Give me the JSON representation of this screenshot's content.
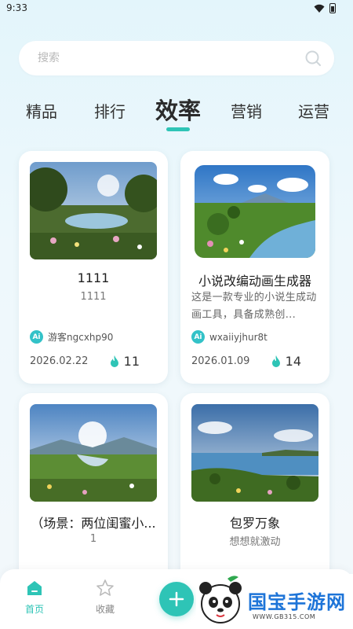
{
  "status_bar": {
    "time": "9:33"
  },
  "search": {
    "placeholder": "搜索"
  },
  "tabs": [
    {
      "label": "精品"
    },
    {
      "label": "排行"
    },
    {
      "label": "效率"
    },
    {
      "label": "营销"
    },
    {
      "label": "运营"
    }
  ],
  "active_tab": "效率",
  "cards": [
    {
      "title": "1111",
      "subtitle": "1111",
      "author": "游客ngcxhp90",
      "date": "2026.02.22",
      "hot": "11"
    },
    {
      "title": "小说改编动画生成器",
      "description": "这是一款专业的小说生成动画工具，具备成熟创...",
      "author": "wxaiiyjhur8t",
      "date": "2026.01.09",
      "hot": "14"
    },
    {
      "title": "（场景：两位闺蜜小...",
      "subtitle": "1"
    },
    {
      "title": "包罗万象",
      "subtitle": "想想就激动"
    }
  ],
  "ai_badge": "Ai",
  "bottom_nav": {
    "home_label": "首页",
    "favorites_label": "收藏"
  },
  "watermark": {
    "text": "国宝手游网",
    "sub": "WWW.GB315.COM"
  },
  "colors": {
    "accent": "#2ec4b6",
    "flame": "#2ec4b6",
    "background": "#e3f5fb"
  }
}
